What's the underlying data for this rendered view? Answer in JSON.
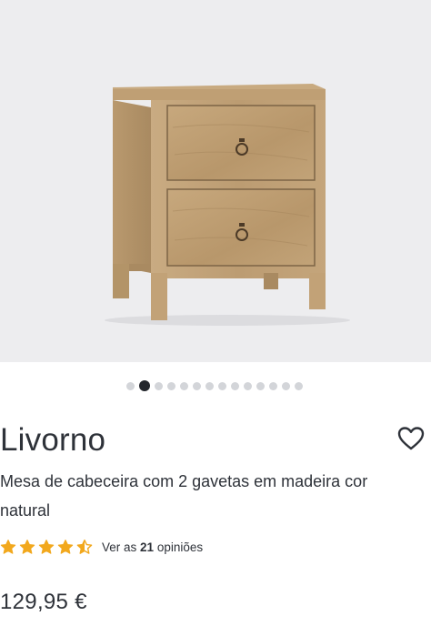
{
  "product": {
    "name": "Livorno",
    "description": "Mesa de cabeceira com 2 gavetas em madeira cor natural",
    "price": "129,95 €",
    "image_description_icon": "nightstand-image"
  },
  "gallery": {
    "total_images": 14,
    "active_index": 1
  },
  "rating": {
    "value": 4.5,
    "max": 5,
    "reviews_prefix": "Ver as",
    "reviews_count": "21",
    "reviews_suffix": "opiniões"
  },
  "colors": {
    "star": "#f2a81d",
    "text": "#2e3239",
    "gallery_bg": "#ededef",
    "dot_active": "#23262c",
    "dot_inactive": "#d3d5d9"
  },
  "icons": {
    "favorite": "heart-outline-icon",
    "star_full": "star-icon",
    "star_half": "star-half-icon"
  }
}
